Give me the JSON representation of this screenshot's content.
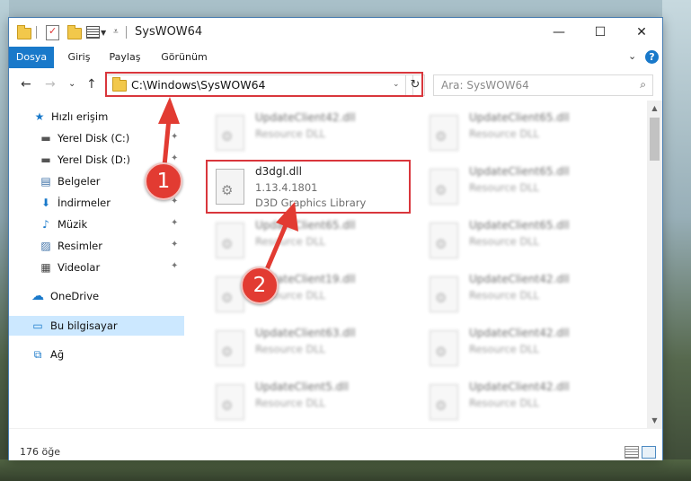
{
  "window": {
    "title": "SysWOW64",
    "controls": {
      "minimize": "—",
      "maximize": "☐",
      "close": "✕"
    }
  },
  "ribbon": {
    "tabs": [
      {
        "label": "Dosya",
        "active": true
      },
      {
        "label": "Giriş",
        "active": false
      },
      {
        "label": "Paylaş",
        "active": false
      },
      {
        "label": "Görünüm",
        "active": false
      }
    ],
    "expand": "⌄",
    "help": "?"
  },
  "nav": {
    "back": "←",
    "forward": "→",
    "recent": "⌄",
    "up": "↑",
    "address": "C:\\Windows\\SysWOW64",
    "address_dropdown": "⌄",
    "refresh": "↻",
    "search_placeholder": "Ara: SysWOW64",
    "search_icon": "⌕"
  },
  "sidebar": {
    "items": [
      {
        "label": "Hızlı erişim",
        "icon": "star-icon",
        "glyph": "★",
        "color": "#1979ca",
        "pinned": false
      },
      {
        "label": "Yerel Disk (C:)",
        "icon": "drive-icon",
        "glyph": "▬",
        "color": "#555555",
        "pinned": true
      },
      {
        "label": "Yerel Disk (D:)",
        "icon": "drive-icon",
        "glyph": "▬",
        "color": "#555555",
        "pinned": true
      },
      {
        "label": "Belgeler",
        "icon": "document-icon",
        "glyph": "▤",
        "color": "#3a6ea5",
        "pinned": true
      },
      {
        "label": "İndirmeler",
        "icon": "download-icon",
        "glyph": "⬇",
        "color": "#1979ca",
        "pinned": true
      },
      {
        "label": "Müzik",
        "icon": "music-icon",
        "glyph": "♪",
        "color": "#1979ca",
        "pinned": true
      },
      {
        "label": "Resimler",
        "icon": "pictures-icon",
        "glyph": "▨",
        "color": "#3a6ea5",
        "pinned": true
      },
      {
        "label": "Videolar",
        "icon": "video-icon",
        "glyph": "▦",
        "color": "#444444",
        "pinned": true
      },
      {
        "label": "OneDrive",
        "icon": "cloud-icon",
        "glyph": "☁",
        "color": "#1979ca",
        "pinned": false
      },
      {
        "label": "Bu bilgisayar",
        "icon": "computer-icon",
        "glyph": "▭",
        "color": "#1979ca",
        "pinned": false,
        "selected": true
      },
      {
        "label": "Ağ",
        "icon": "network-icon",
        "glyph": "⧉",
        "color": "#1979ca",
        "pinned": false
      }
    ],
    "pin_glyph": "📌"
  },
  "files": {
    "col1": [
      {
        "name": "UpdateClient42.dll",
        "line2": "Resource DLL",
        "line3": ""
      },
      {
        "name": "d3dgl.dll",
        "line2": "1.13.4.1801",
        "line3": "D3D Graphics Library"
      },
      {
        "name": "UpdateClient65.dll",
        "line2": "Resource DLL",
        "line3": ""
      },
      {
        "name": "UpdateClient19.dll",
        "line2": "Resource DLL",
        "line3": ""
      },
      {
        "name": "UpdateClient63.dll",
        "line2": "Resource DLL",
        "line3": ""
      },
      {
        "name": "UpdateClient5.dll",
        "line2": "Resource DLL",
        "line3": ""
      }
    ],
    "col2": [
      {
        "name": "UpdateClient65.dll",
        "line2": "Resource DLL",
        "line3": ""
      },
      {
        "name": "UpdateClient65.dll",
        "line2": "Resource DLL",
        "line3": ""
      },
      {
        "name": "UpdateClient65.dll",
        "line2": "Resource DLL",
        "line3": ""
      },
      {
        "name": "UpdateClient42.dll",
        "line2": "Resource DLL",
        "line3": ""
      },
      {
        "name": "UpdateClient42.dll",
        "line2": "Resource DLL",
        "line3": ""
      },
      {
        "name": "UpdateClient42.dll",
        "line2": "Resource DLL",
        "line3": ""
      }
    ]
  },
  "status": {
    "count": "176 öğe"
  },
  "annotations": {
    "step1": "1",
    "step2": "2",
    "color": "#e23b32"
  }
}
